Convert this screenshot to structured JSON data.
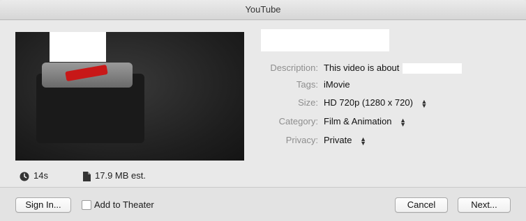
{
  "window": {
    "title": "YouTube"
  },
  "meta": {
    "duration": "14s",
    "size_estimate": "17.9 MB est."
  },
  "form": {
    "description": {
      "label": "Description:",
      "value": "This video is about"
    },
    "tags": {
      "label": "Tags:",
      "value": "iMovie"
    },
    "size": {
      "label": "Size:",
      "value": "HD 720p (1280 x 720)"
    },
    "category": {
      "label": "Category:",
      "value": "Film & Animation"
    },
    "privacy": {
      "label": "Privacy:",
      "value": "Private"
    }
  },
  "footer": {
    "sign_in": "Sign In...",
    "add_to_theater": "Add to Theater",
    "add_to_theater_checked": false,
    "cancel": "Cancel",
    "next": "Next..."
  },
  "icons": {
    "clock": "clock-icon",
    "file": "file-icon",
    "stepper": "stepper-icon"
  }
}
